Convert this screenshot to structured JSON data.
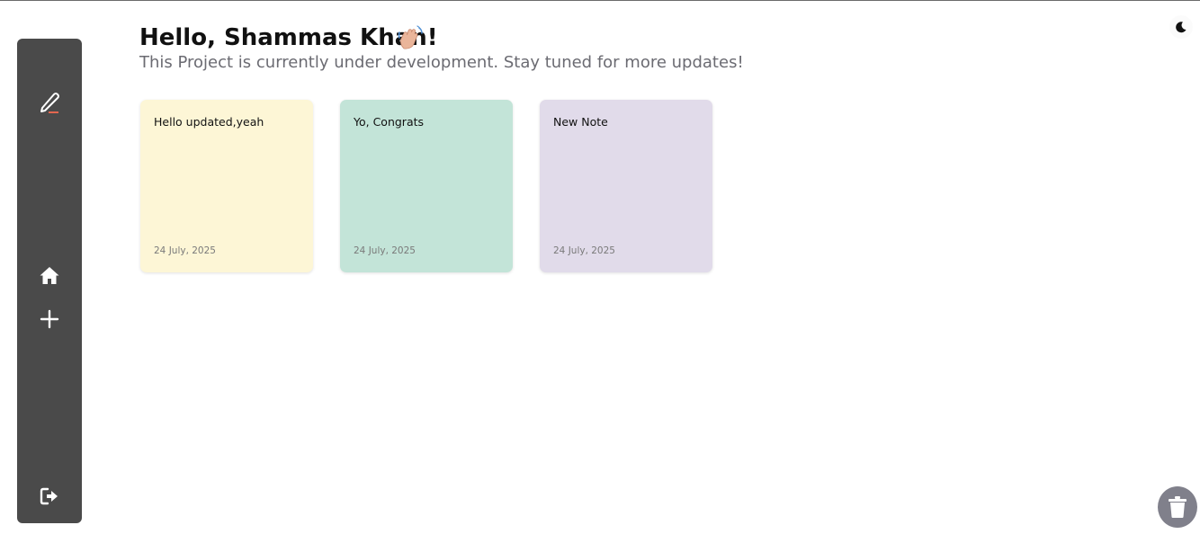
{
  "header": {
    "greeting": "Hello, Shammas Khan!",
    "subtitle": "This Project is currently under development. Stay tuned for more updates!"
  },
  "sidebar": {
    "items": [
      {
        "name": "logo",
        "icon": "pencil-icon"
      },
      {
        "name": "home",
        "icon": "home-icon"
      },
      {
        "name": "add",
        "icon": "plus-icon"
      },
      {
        "name": "logout",
        "icon": "logout-icon"
      }
    ]
  },
  "notes": [
    {
      "title": "Hello updated,yeah",
      "date": "24 July, 2025",
      "color": "#fdf6d6"
    },
    {
      "title": "Yo, Congrats",
      "date": "24 July, 2025",
      "color": "#c3e4d8"
    },
    {
      "title": "New Note",
      "date": "24 July, 2025",
      "color": "#e1dbea"
    }
  ],
  "colors": {
    "sidebar": "#4a4a4a",
    "trash": "#80808b",
    "accent": "#e2674f"
  },
  "icons": {
    "theme_toggle": "moon-icon",
    "trash": "trash-icon",
    "wave": "waving-hand-icon"
  }
}
